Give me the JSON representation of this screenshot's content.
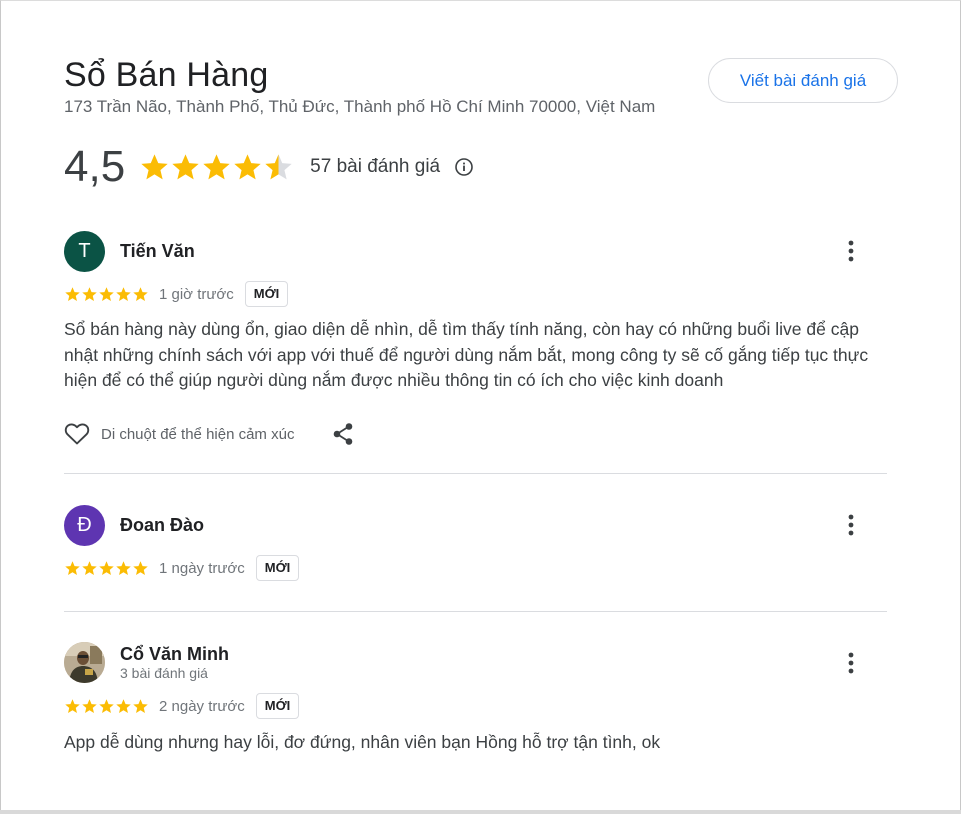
{
  "place": {
    "title": "Sổ Bán Hàng",
    "address": "173 Trần Não, Thành Phố, Thủ Đức, Thành phố Hồ Chí Minh 70000, Việt Nam",
    "write_review_label": "Viết bài đánh giá",
    "rating_value": "4,5",
    "rating_stars": 4.5,
    "review_count": "57 bài đánh giá",
    "info_icon": "info-icon"
  },
  "reviews": [
    {
      "name": "Tiến Văn",
      "avatar_letter": "T",
      "avatar_color": "#0b5345",
      "stars": 5,
      "time": "1 giờ trước",
      "badge": "MỚI",
      "text": "Sổ bán hàng này dùng ổn, giao diện dễ nhìn, dễ tìm thấy tính năng, còn hay có những buổi live để cập nhật những chính sách với app với thuế để người dùng nắm bắt, mong công ty sẽ cố gắng tiếp tục thực hiện để có thể giúp người dùng nắm được nhiều thông tin có ích cho việc kinh doanh",
      "react_hint": "Di chuột để thể hiện cảm xúc"
    },
    {
      "name": "Đoan Đào",
      "avatar_letter": "Đ",
      "avatar_color": "#5e35b1",
      "stars": 5,
      "time": "1 ngày trước",
      "badge": "MỚI"
    },
    {
      "name": "Cổ Văn Minh",
      "subtitle": "3 bài đánh giá",
      "avatar_type": "photo",
      "stars": 5,
      "time": "2 ngày trước",
      "badge": "MỚI",
      "text": "App dễ dùng nhưng hay lỗi, đơ đứng, nhân viên bạn Hồng hỗ trợ tận tình, ok"
    }
  ],
  "colors": {
    "star": "#fbbc04",
    "star_empty": "#dadce0",
    "accent": "#1a73e8",
    "text_secondary": "#70757a",
    "divider": "#dadce0"
  }
}
